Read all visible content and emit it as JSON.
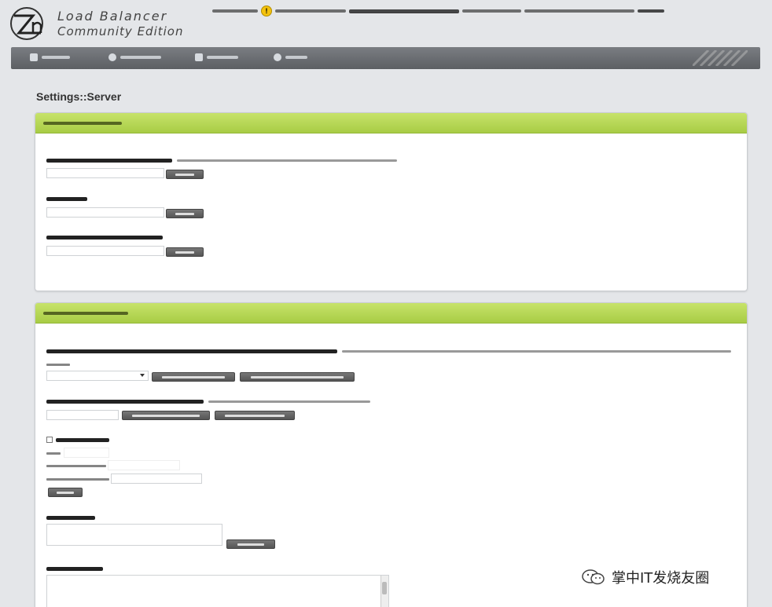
{
  "header": {
    "logo_line1": "Load Balancer",
    "logo_line2": "Community Edition",
    "warning_icon": "warning-icon"
  },
  "nav": {
    "items": [
      {
        "icon": "home-icon",
        "label": ""
      },
      {
        "icon": "monitoring-icon",
        "label": ""
      },
      {
        "icon": "settings-icon",
        "label": ""
      },
      {
        "icon": "about-icon",
        "label": ""
      }
    ]
  },
  "page": {
    "title": "Settings::Server"
  },
  "global_panel": {
    "title": "",
    "fields": [
      {
        "label": "",
        "hint": "",
        "value": "",
        "button": ""
      },
      {
        "label": "",
        "hint": "",
        "value": "",
        "button": ""
      },
      {
        "label": "",
        "hint": "",
        "value": "",
        "button": ""
      }
    ]
  },
  "local_panel": {
    "title": "",
    "mgmt_interface": {
      "label": "",
      "hint": "",
      "selected": "",
      "btn_save": "",
      "btn_restart": ""
    },
    "https_port": {
      "label": "",
      "hint": "",
      "value": "",
      "btn_change": "",
      "btn_restart": ""
    },
    "snmp": {
      "label": "",
      "port_value": "",
      "community_value": "",
      "ip_value": "",
      "button": ""
    },
    "dns": {
      "label": "",
      "value": "",
      "button": ""
    },
    "apt": {
      "label": "",
      "lines": [
        "",
        "",
        ""
      ]
    }
  },
  "watermark": {
    "text": "掌中IT发烧友圈",
    "icon": "wechat-icon"
  },
  "colors": {
    "accent_green": "#a8cc45",
    "nav_gray": "#5c5f63"
  }
}
